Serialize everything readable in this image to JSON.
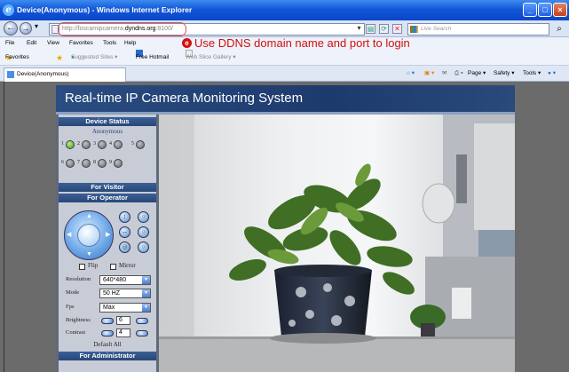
{
  "window": {
    "title": "Device(Anonymous) - Windows Internet Explorer"
  },
  "address": {
    "prefix": "http://",
    "subdomain": "foscamipcamera.",
    "domain": "dyndns.org",
    "port": ":8100/"
  },
  "search": {
    "placeholder": "Live Search"
  },
  "menu": [
    "File",
    "Edit",
    "View",
    "Favorites",
    "Tools",
    "Help"
  ],
  "annotation": "Use DDNS domain name and port to login",
  "favorites": {
    "label": "Favorites",
    "items": [
      "Suggested Sites ▾",
      "Free Hotmail",
      "Web Slice Gallery ▾"
    ]
  },
  "tab": {
    "label": "Device(Anonymous)"
  },
  "tab_tools": [
    "Page ▾",
    "Safety ▾",
    "Tools ▾"
  ],
  "app": {
    "title": "Real-time IP Camera Monitoring System",
    "sections": {
      "device_status": "Device Status",
      "for_visitor": "For Visitor",
      "for_operator": "For Operator",
      "for_admin": "For Administrator"
    },
    "user": "Anonymous",
    "channels": [
      "1",
      "2",
      "3",
      "4",
      "5",
      "6",
      "7",
      "8",
      "9"
    ],
    "flip": "Flip",
    "mirror": "Mirror",
    "settings": {
      "resolution": {
        "label": "Resolution",
        "value": "640*480"
      },
      "mode": {
        "label": "Mode",
        "value": "50 HZ"
      },
      "fps": {
        "label": "Fps",
        "value": "Max"
      },
      "brightness": {
        "label": "Brightness",
        "value": "6"
      },
      "contrast": {
        "label": "Contrast",
        "value": "4"
      }
    },
    "default_all": "Default All"
  },
  "colors": {
    "annotation": "#d21010",
    "header": "#2b4d82",
    "section": "#3a5f97"
  }
}
